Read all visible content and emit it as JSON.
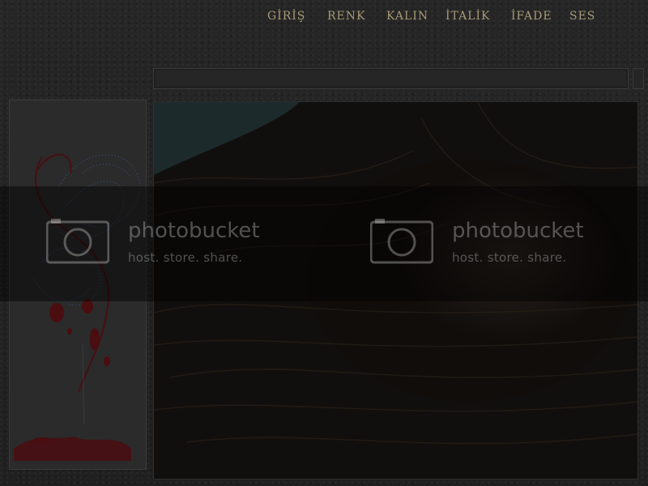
{
  "menu": {
    "items": [
      {
        "label": "GİRİŞ"
      },
      {
        "label": "RENK"
      },
      {
        "label": "KALIN"
      },
      {
        "label": "İTALİK"
      },
      {
        "label": "İFADE"
      },
      {
        "label": "SES"
      }
    ]
  },
  "watermark": {
    "brand": "photobucket",
    "tagline": "host. store. share."
  },
  "colors": {
    "menu_text": "#a69a76",
    "background": "#242424",
    "blood_accent": "#4a0d10",
    "spark_accent": "#3a5ca8"
  },
  "icons": {
    "watermark": "camera-icon"
  }
}
